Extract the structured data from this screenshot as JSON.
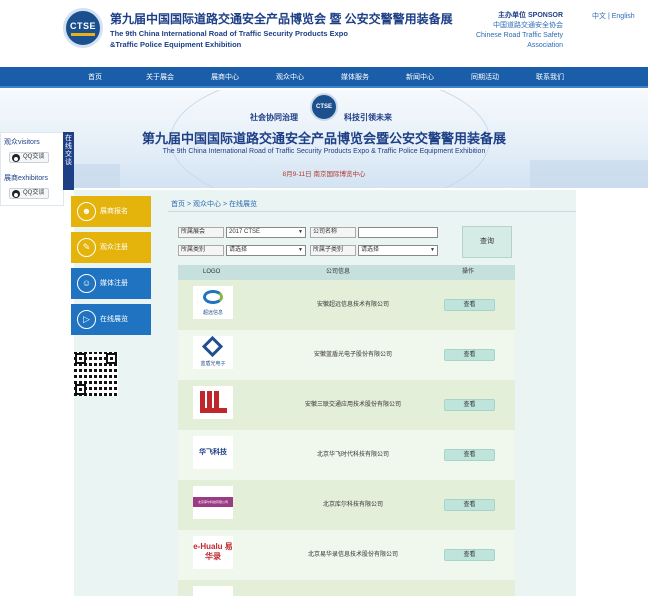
{
  "header": {
    "logo_text": "CTSE",
    "title_cn": "第九届中国国际道路交通安全产品博览会 暨 公安交警警用装备展",
    "title_en_1": "The 9th China International Road of Traffic Security Products Expo",
    "title_en_2": "&Traffic Police Equipment Exhibition",
    "sponsor_label": "主办单位 SPONSOR",
    "sponsor_cn": "中国道路交通安全协会",
    "sponsor_en_1": "Chinese Road Traffic Safety",
    "sponsor_en_2": "Association",
    "lang_cn": "中文",
    "lang_sep": "|",
    "lang_en": "English"
  },
  "nav": {
    "items": [
      {
        "label": "首页"
      },
      {
        "label": "关于展会"
      },
      {
        "label": "展商中心"
      },
      {
        "label": "观众中心"
      },
      {
        "label": "媒体服务"
      },
      {
        "label": "新闻中心"
      },
      {
        "label": "同期活动"
      },
      {
        "label": "联系我们"
      }
    ]
  },
  "banner": {
    "slogan_left": "社会协同治理",
    "slogan_right": "科技引领未来",
    "title_cn": "第九届中国国际道路交通安全产品博览会暨公安交警警用装备展",
    "title_en": "The 9th China International Road of Traffic Security Products Expo & Traffic Police Equipment Exhibition",
    "date": "8月9-11日  南京国际博览中心"
  },
  "float_chat": {
    "visitors_label": "观众visitors",
    "exhibitors_label": "展商exhibitors",
    "qq_label": "QQ交谈",
    "tab_label": "在线交谈"
  },
  "sidebar": {
    "items": [
      {
        "label": "展商报名",
        "icon": "user-icon",
        "color": "#e4b40c"
      },
      {
        "label": "观众注册",
        "icon": "pencil-icon",
        "color": "#e4b40c"
      },
      {
        "label": "媒体注册",
        "icon": "person-badge-icon",
        "color": "#1f73c0"
      },
      {
        "label": "在线展览",
        "icon": "play-icon",
        "color": "#1f73c0"
      }
    ]
  },
  "breadcrumb": {
    "home": "首页",
    "sep": ">",
    "section": "观众中心",
    "page": "在线展览"
  },
  "filters": {
    "expo_label": "所属展会",
    "expo_value": "2017 CTSE",
    "company_label": "公司名称",
    "company_value": "",
    "category_label": "所属类别",
    "category_value": "请选择",
    "subcategory_label": "所属子类别",
    "subcategory_value": "请选择",
    "query_label": "查询"
  },
  "table": {
    "headers": {
      "logo": "LOGO",
      "company": "公司信息",
      "action": "操作"
    },
    "view_label": "查看",
    "rows": [
      {
        "company": "安徽超远信息技术有限公司",
        "logo_text": "超远信息"
      },
      {
        "company": "安徽蓝盾光电子股份有限公司",
        "logo_text": "蓝盾光电子"
      },
      {
        "company": "安徽三联交通应用技术股份有限公司",
        "logo_text": ""
      },
      {
        "company": "北京华飞时代科技有限公司",
        "logo_text": "华飞科技"
      },
      {
        "company": "北京库尔科技有限公司",
        "logo_text": "北京库尔科技有限公司"
      },
      {
        "company": "北京易华录信息技术股份有限公司",
        "logo_text": "e-Hualu 易华录"
      }
    ]
  }
}
